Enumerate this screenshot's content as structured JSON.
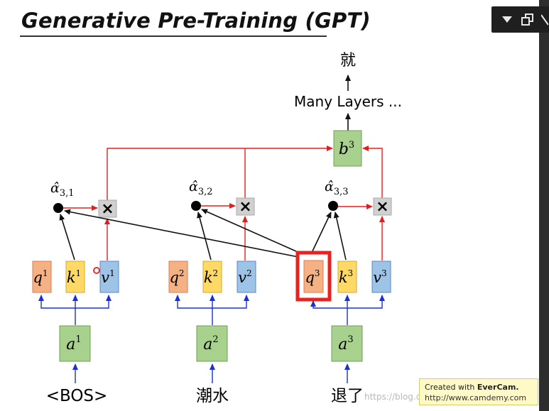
{
  "title": "Generative Pre-Training (GPT)",
  "output_token": "就",
  "many_layers": "Many Layers ...",
  "output_vector": {
    "base": "b",
    "sup": "3"
  },
  "attention_scores": [
    {
      "base": "α̂",
      "sub": "3,1"
    },
    {
      "base": "α̂",
      "sub": "3,2"
    },
    {
      "base": "α̂",
      "sub": "3,3"
    }
  ],
  "multiply_symbol": "×",
  "groups": [
    {
      "q": {
        "base": "q",
        "sup": "1"
      },
      "k": {
        "base": "k",
        "sup": "1"
      },
      "v": {
        "base": "v",
        "sup": "1"
      },
      "a": {
        "base": "a",
        "sup": "1"
      },
      "token": "<BOS>"
    },
    {
      "q": {
        "base": "q",
        "sup": "2"
      },
      "k": {
        "base": "k",
        "sup": "2"
      },
      "v": {
        "base": "v",
        "sup": "2"
      },
      "a": {
        "base": "a",
        "sup": "2"
      },
      "token": "潮水"
    },
    {
      "q": {
        "base": "q",
        "sup": "3"
      },
      "k": {
        "base": "k",
        "sup": "3"
      },
      "v": {
        "base": "v",
        "sup": "3"
      },
      "a": {
        "base": "a",
        "sup": "3"
      },
      "token": "退了"
    }
  ],
  "watermark": "https://blog.csdn.net/...",
  "evercam": {
    "prefix": "Created with ",
    "brand": "EverCam.",
    "url": "http://www.camdemy.com"
  },
  "colors": {
    "q_fill": "#f4b183",
    "q_stroke": "#e07b4d",
    "k_fill": "#ffd966",
    "k_stroke": "#d8a92b",
    "v_fill": "#9dc3e6",
    "v_stroke": "#5b87c0",
    "a_fill": "#a9d18e",
    "a_stroke": "#6f9f55",
    "highlight": "#e8231f",
    "red_line": "#e02020",
    "blue_line": "#1c2fd0"
  }
}
